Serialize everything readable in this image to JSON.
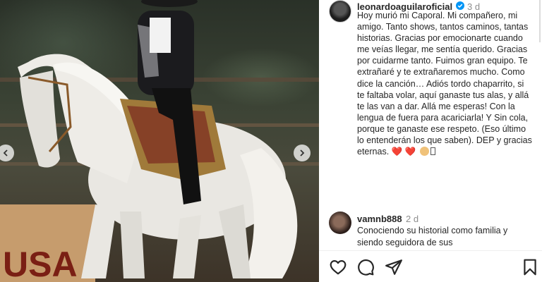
{
  "post": {
    "username": "leonardoaguilaroficial",
    "time": "3 d",
    "caption": "Hoy murió mi Caporal. Mi compañero, mi amigo. Tanto shows, tantos caminos, tantas historias. Gracias por emocionarte cuando me veías llegar, me sentía querido. Gracias por cuidarme tanto. Fuimos gran equipo. Te extrañaré y te extrañaremos mucho. Como dice la canción… Adiós tordo chaparrito, si te faltaba volar, aquí ganaste tus alas, y allá te las van a dar. Allá me esperas! Con la lengua de fuera para acariciarla! Y Sin cola, porque te ganaste ese respeto. (Eso último lo entenderán los que saben). DEP y gracias eternas.",
    "caption_hearts": "❤️ ❤️",
    "photo_banner_text": "USA"
  },
  "comment": {
    "username": "vamnb888",
    "time": "2 d",
    "text": "Conociendo su historial como familia y siendo seguidora de sus"
  },
  "icons": [
    "verified-badge-icon",
    "chevron-left-icon",
    "chevron-right-icon",
    "heart-icon",
    "comment-bubble-icon",
    "send-icon",
    "bookmark-icon"
  ],
  "colors": {
    "verified": "#0095f6",
    "heart": "#ed4956",
    "muted": "#8e8e8e",
    "text": "#262626"
  }
}
